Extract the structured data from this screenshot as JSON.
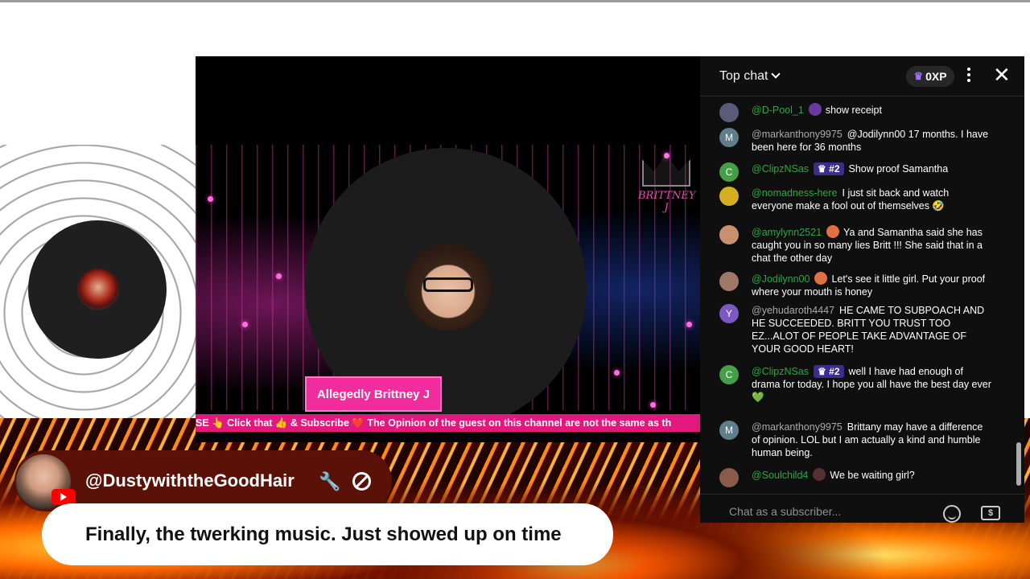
{
  "colors": {
    "accent_pink": "#f12d9d",
    "member_green": "#2ba640",
    "chat_bg": "#0f0f0f",
    "featured_bar": "#5a1107"
  },
  "stream": {
    "guest_name": "Allegedly Brittney J",
    "brand_logo_text": "BRITTNEY J",
    "ticker_text": "SE 👆 Click that 👍 & Subscribe ❤️ The Opinion of the guest on this channel are not the same as th"
  },
  "featured_comment": {
    "author": "@DustywiththeGoodHair",
    "wrench_icon": "wrench-icon",
    "ban_icon": "ban-icon",
    "text": "Finally, the twerking music. Just showed up on time"
  },
  "chat": {
    "title": "Top chat",
    "xp_label": "0XP",
    "input_placeholder": "Chat as a subscriber...",
    "messages": [
      {
        "author": "@D-Pool_1",
        "text": "show receipt",
        "avatar_letter": "",
        "avatar_color": "#5a5a7a"
      },
      {
        "author": "@markanthony9975",
        "text": "@Jodilynn00 17 months. I have been here for 36 months",
        "avatar_letter": "M",
        "avatar_color": "#607d8b"
      },
      {
        "author": "@ClipzNSas",
        "badge": "#2",
        "text": "Show proof Samantha",
        "avatar_letter": "C",
        "avatar_color": "#43a047"
      },
      {
        "author": "@nomadness-here",
        "text": "I just sit back and watch everyone make a fool out of themselves 🤣",
        "avatar_letter": "",
        "avatar_color": "#d4b020"
      },
      {
        "author": "@amylynn2521",
        "text": "Ya and Samantha said she has caught you in so many lies Britt !!! She said that in a chat the other day",
        "avatar_letter": "",
        "avatar_color": "#c89070"
      },
      {
        "author": "@Jodilynn00",
        "text": "Let's see it little girl. Put your proof where your mouth is honey",
        "avatar_letter": "",
        "avatar_color": "#a07868"
      },
      {
        "author": "@yehudaroth4447",
        "text": "HE CAME TO SUBPOACH AND HE SUCCEEDED. BRITT YOU TRUST TOO EZ...ALOT OF PEOPLE TAKE ADVANTAGE OF YOUR GOOD HEART!",
        "avatar_letter": "Y",
        "avatar_color": "#7e57c2"
      },
      {
        "author": "@ClipzNSas",
        "badge": "#2",
        "text": "well I have had enough of drama for today. I hope you all have the best day ever 💚",
        "avatar_letter": "C",
        "avatar_color": "#43a047"
      },
      {
        "author": "@markanthony9975",
        "text": "Brittany may have a difference of opinion. LOL but I am actually a kind and humble human being.",
        "avatar_letter": "M",
        "avatar_color": "#607d8b"
      },
      {
        "author": "@Soulchild4",
        "text": "We be waiting girl?",
        "avatar_letter": "",
        "avatar_color": "#8a5a4a"
      }
    ]
  }
}
